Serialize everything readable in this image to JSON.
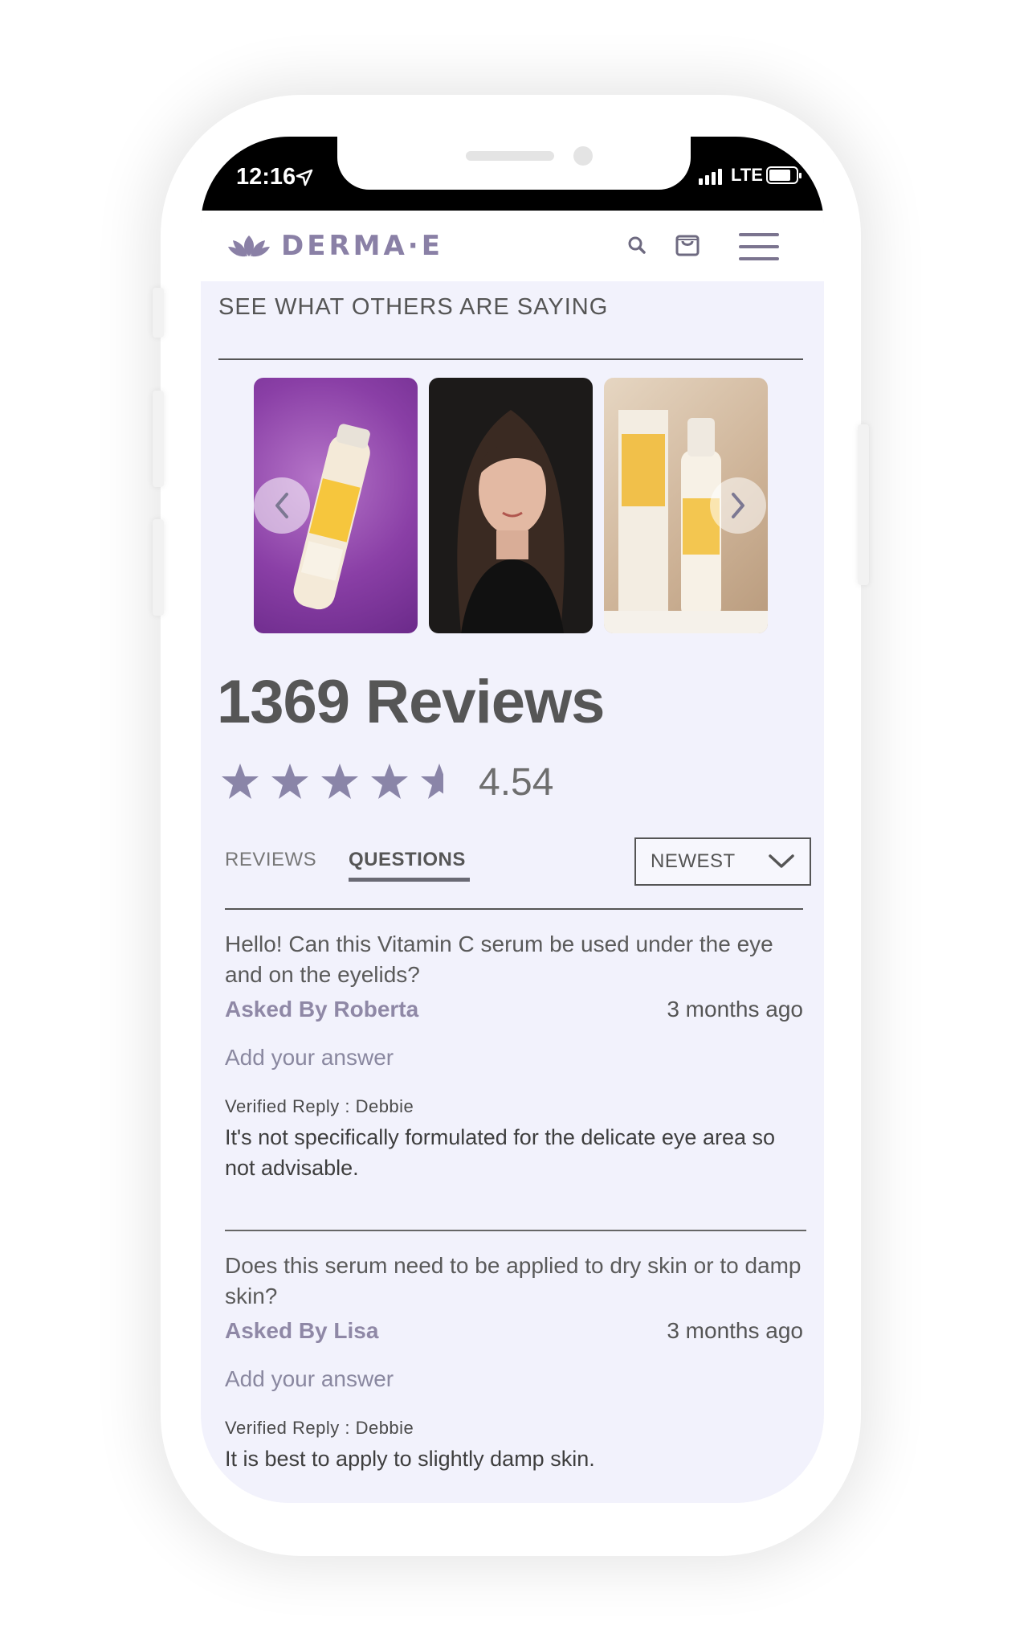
{
  "status_bar": {
    "time": "12:16",
    "network": "LTE"
  },
  "header": {
    "brand": "DERMA·E"
  },
  "section_title": "SEE WHAT OTHERS ARE SAYING",
  "reviews": {
    "count_label": "1369 Reviews",
    "rating": "4.54",
    "stars": {
      "full": 4,
      "partial": 0.54,
      "total": 5
    }
  },
  "tabs": [
    {
      "label": "REVIEWS",
      "active": false
    },
    {
      "label": "QUESTIONS",
      "active": true
    }
  ],
  "sort": {
    "selected": "NEWEST"
  },
  "questions": [
    {
      "question": "Hello! Can this Vitamin C serum be used under the eye and on the eyelids?",
      "asked_by": "Asked By Roberta",
      "date": "3 months ago",
      "add_answer": "Add your answer",
      "reply_label": "Verified Reply : Debbie",
      "reply": "It's not specifically formulated for the delicate eye area so not advisable."
    },
    {
      "question": "Does this serum need to be applied to dry skin or to damp skin?",
      "asked_by": "Asked By Lisa",
      "date": "3 months ago",
      "add_answer": "Add your answer",
      "reply_label": "Verified Reply : Debbie",
      "reply": "It is best to apply to slightly damp skin."
    }
  ],
  "colors": {
    "accent": "#8a80a6",
    "screen_bg": "#f2f2fc",
    "star": "#8a85a8"
  }
}
